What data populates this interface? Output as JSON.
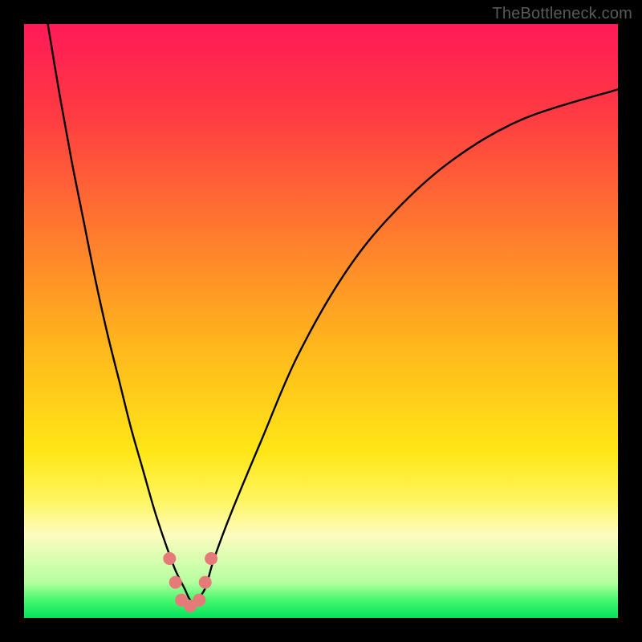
{
  "watermark": "TheBottleneck.com",
  "chart_data": {
    "type": "line",
    "title": "",
    "xlabel": "",
    "ylabel": "",
    "xlim": [
      0,
      100
    ],
    "ylim": [
      0,
      100
    ],
    "grid": false,
    "legend": false,
    "background_gradient": {
      "stops": [
        {
          "pos": 0.0,
          "color": "#ff1a58"
        },
        {
          "pos": 0.15,
          "color": "#ff3a43"
        },
        {
          "pos": 0.35,
          "color": "#ff7a2e"
        },
        {
          "pos": 0.55,
          "color": "#ffb91c"
        },
        {
          "pos": 0.72,
          "color": "#ffe617"
        },
        {
          "pos": 0.8,
          "color": "#fff55e"
        },
        {
          "pos": 0.86,
          "color": "#fdfcbf"
        },
        {
          "pos": 0.94,
          "color": "#b6ffa0"
        },
        {
          "pos": 0.97,
          "color": "#47f86f"
        },
        {
          "pos": 1.0,
          "color": "#00e35b"
        }
      ]
    },
    "series": [
      {
        "name": "bottleneck-curve",
        "color": "#000000",
        "x": [
          4,
          6,
          8,
          10,
          12,
          14,
          16,
          18,
          20,
          22,
          24,
          25.5,
          27,
          28,
          29,
          30.5,
          32,
          35,
          40,
          46,
          54,
          62,
          72,
          84,
          100
        ],
        "y": [
          100,
          88,
          77,
          67,
          57,
          48,
          40,
          32,
          25,
          18,
          12,
          8,
          5,
          3,
          3,
          5,
          10,
          18,
          30,
          44,
          58,
          68,
          77,
          84,
          89
        ]
      }
    ],
    "markers": {
      "name": "highlight-dots",
      "color": "#e67a78",
      "radius_px": 8,
      "points": [
        {
          "x": 24.5,
          "y": 10
        },
        {
          "x": 25.5,
          "y": 6
        },
        {
          "x": 26.5,
          "y": 3
        },
        {
          "x": 28.0,
          "y": 2
        },
        {
          "x": 29.5,
          "y": 3
        },
        {
          "x": 30.5,
          "y": 6
        },
        {
          "x": 31.5,
          "y": 10
        }
      ]
    }
  }
}
